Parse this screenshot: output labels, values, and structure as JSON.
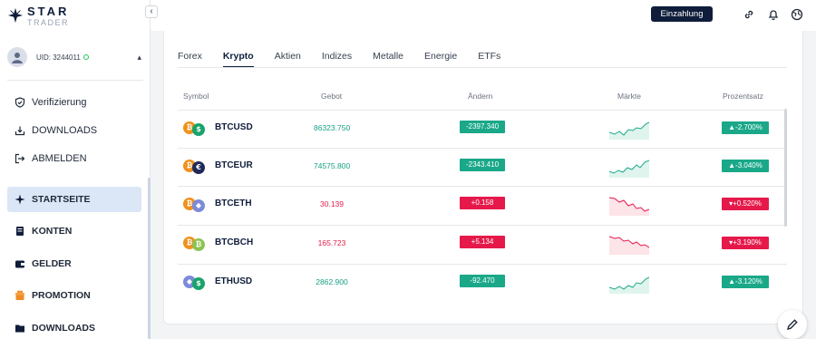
{
  "brand": {
    "name": "STAR",
    "sub": "TRADER"
  },
  "user": {
    "uid": "UID: 3244011"
  },
  "sidebar": {
    "items": [
      {
        "label": "Verifizierung",
        "icon": "shield-check-icon"
      },
      {
        "label": "DOWNLOADS",
        "icon": "download-icon"
      },
      {
        "label": "ABMELDEN",
        "icon": "logout-icon"
      },
      {
        "label": "STARTSEITE",
        "icon": "star-icon"
      },
      {
        "label": "KONTEN",
        "icon": "document-icon"
      },
      {
        "label": "GELDER",
        "icon": "wallet-icon"
      },
      {
        "label": "PROMOTION",
        "icon": "gift-icon"
      },
      {
        "label": "DOWNLOADS",
        "icon": "folder-download-icon"
      }
    ]
  },
  "header": {
    "deposit_label": "Einzahlung"
  },
  "tabs": [
    "Forex",
    "Krypto",
    "Aktien",
    "Indizes",
    "Metalle",
    "Energie",
    "ETFs"
  ],
  "table": {
    "headers": [
      "Symbol",
      "Gebot",
      "Ändern",
      "Märkte",
      "Prozentsatz"
    ],
    "rows": [
      {
        "symbol": "BTCUSD",
        "bid": "86323.750",
        "change": "-2397.340",
        "percent": "▲-2.700%",
        "trend": "up"
      },
      {
        "symbol": "BTCEUR",
        "bid": "74575.800",
        "change": "-2343.410",
        "percent": "▲-3.040%",
        "trend": "up"
      },
      {
        "symbol": "BTCETH",
        "bid": "30.139",
        "change": "+0.158",
        "percent": "▾+0.520%",
        "trend": "down"
      },
      {
        "symbol": "BTCBCH",
        "bid": "165.723",
        "change": "+5.134",
        "percent": "▾+3.190%",
        "trend": "down"
      },
      {
        "symbol": "ETHUSD",
        "bid": "2862.900",
        "change": "-92.470",
        "percent": "▲-3.120%",
        "trend": "up"
      }
    ]
  },
  "colors": {
    "up": "#1aa889",
    "down": "#e6194b",
    "brand": "#0f1d3b",
    "active_nav": "#dbe7f6"
  }
}
